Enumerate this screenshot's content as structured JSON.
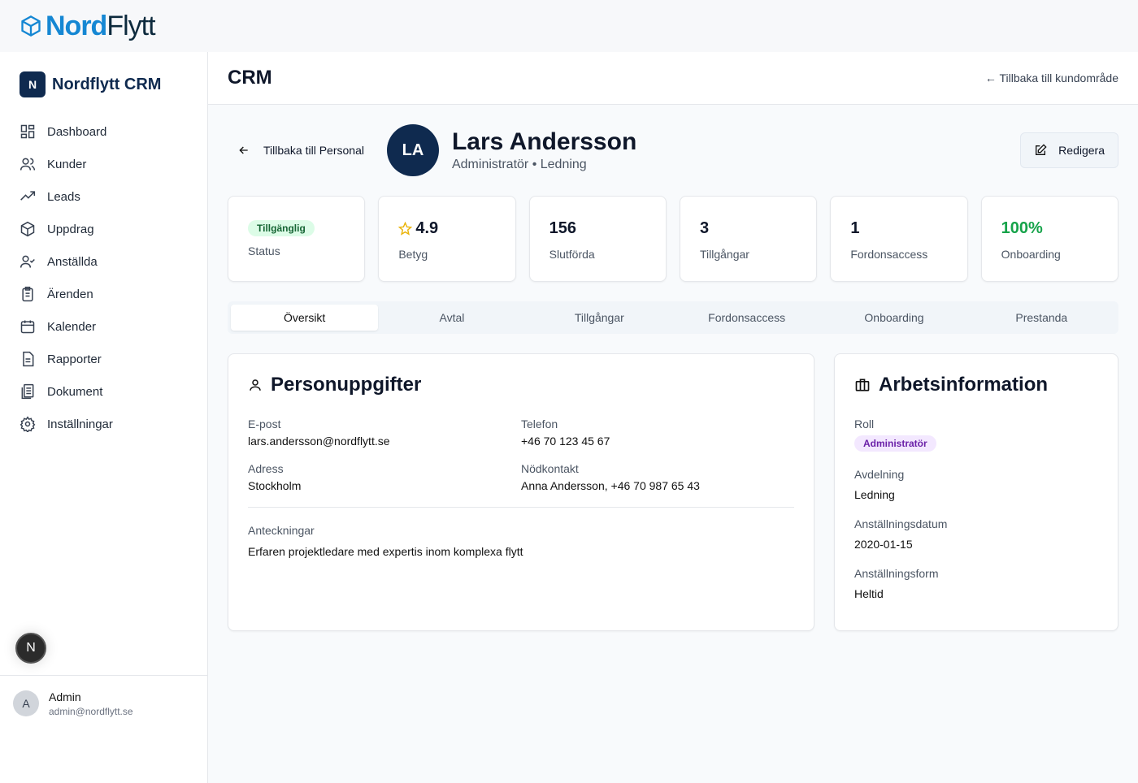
{
  "logo": {
    "part1": "Nord",
    "part2": "Flytt"
  },
  "sidebar": {
    "brand_initial": "N",
    "brand": "Nordflytt CRM",
    "items": [
      {
        "label": "Dashboard"
      },
      {
        "label": "Kunder"
      },
      {
        "label": "Leads"
      },
      {
        "label": "Uppdrag"
      },
      {
        "label": "Anställda"
      },
      {
        "label": "Ärenden"
      },
      {
        "label": "Kalender"
      },
      {
        "label": "Rapporter"
      },
      {
        "label": "Dokument"
      },
      {
        "label": "Inställningar"
      }
    ],
    "badge": "N",
    "user": {
      "initial": "A",
      "name": "Admin",
      "email": "admin@nordflytt.se"
    }
  },
  "header": {
    "title": "CRM",
    "back": "← Tillbaka till kundområde"
  },
  "profile": {
    "back": "Tillbaka till Personal",
    "initials": "LA",
    "name": "Lars Andersson",
    "role": "Administratör",
    "dept": "Ledning",
    "sep": "•",
    "edit": "Redigera"
  },
  "stats": [
    {
      "value": "Tillgänglig",
      "label": "Status"
    },
    {
      "value": "4.9",
      "label": "Betyg"
    },
    {
      "value": "156",
      "label": "Slutförda"
    },
    {
      "value": "3",
      "label": "Tillgångar"
    },
    {
      "value": "1",
      "label": "Fordonsaccess"
    },
    {
      "value": "100%",
      "label": "Onboarding"
    }
  ],
  "tabs": [
    "Översikt",
    "Avtal",
    "Tillgångar",
    "Fordonsaccess",
    "Onboarding",
    "Prestanda"
  ],
  "personal": {
    "title": "Personuppgifter",
    "email_label": "E-post",
    "email": "lars.andersson@nordflytt.se",
    "phone_label": "Telefon",
    "phone": "+46 70 123 45 67",
    "address_label": "Adress",
    "address": "Stockholm",
    "emergency_label": "Nödkontakt",
    "emergency": "Anna Andersson, +46 70 987 65 43",
    "notes_label": "Anteckningar",
    "notes": "Erfaren projektledare med expertis inom komplexa flytt"
  },
  "work": {
    "title": "Arbetsinformation",
    "role_label": "Roll",
    "role": "Administratör",
    "dept_label": "Avdelning",
    "dept": "Ledning",
    "date_label": "Anställningsdatum",
    "date": "2020-01-15",
    "form_label": "Anställningsform",
    "form": "Heltid"
  },
  "colors": {
    "navy": "#0f2a4f",
    "brand_blue": "#1587d3",
    "green": "#16a34a",
    "star": "#eab308"
  }
}
